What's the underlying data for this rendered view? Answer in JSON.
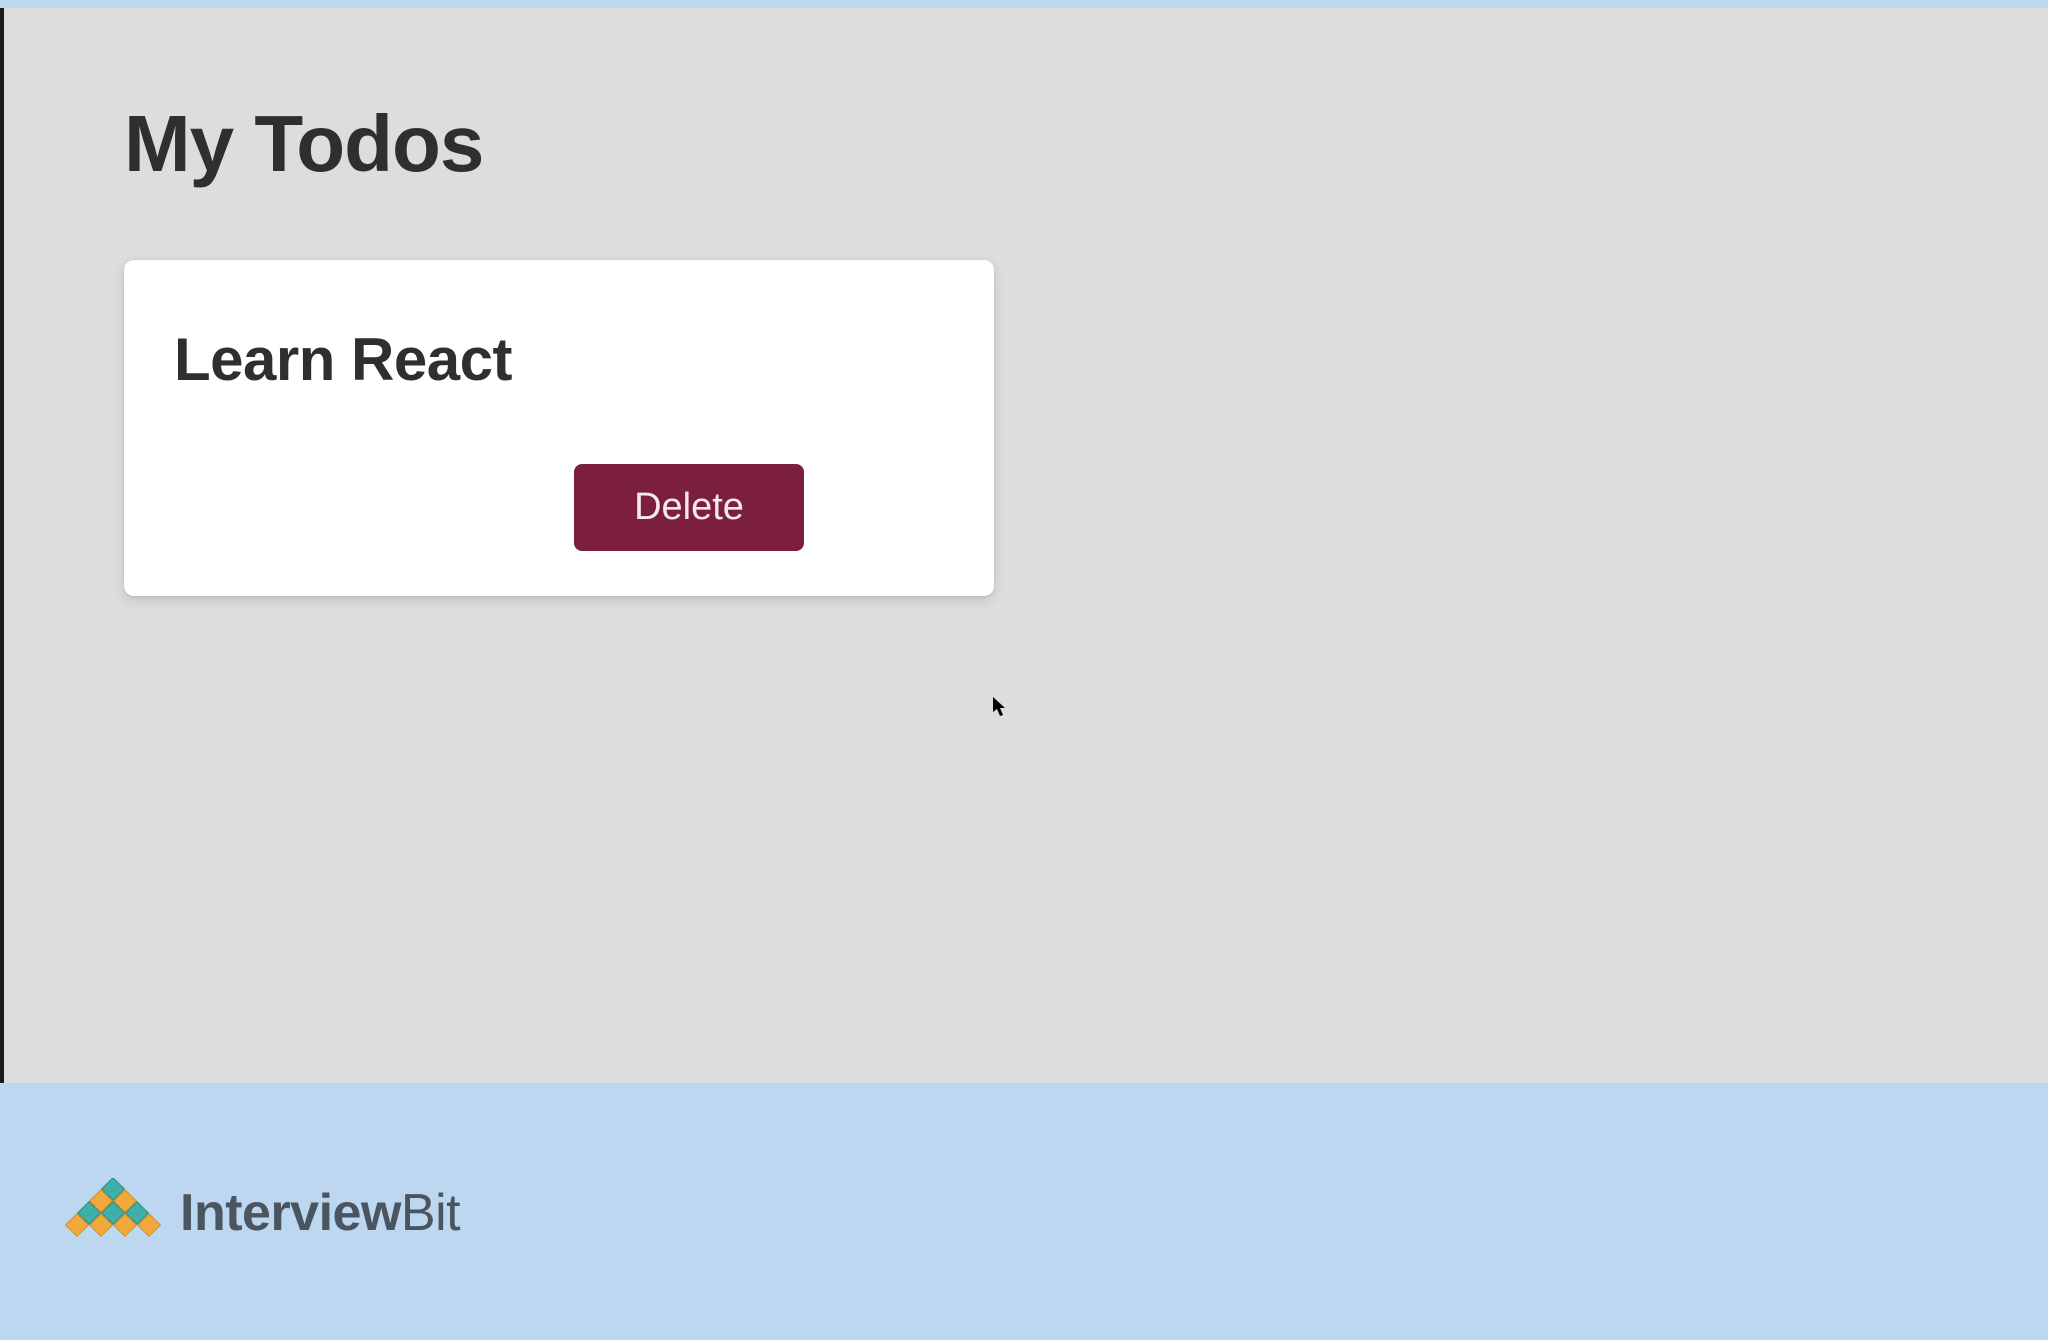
{
  "header": {
    "title": "My Todos"
  },
  "todos": [
    {
      "title": "Learn React",
      "delete_label": "Delete"
    }
  ],
  "footer": {
    "brand_bold": "Interview",
    "brand_light": "Bit"
  },
  "colors": {
    "page_bg": "#bdd7f0",
    "app_bg": "#dddddd",
    "card_bg": "#ffffff",
    "text_dark": "#2f2f2f",
    "button_bg": "#7b1f3d",
    "button_text": "#f5e9ed",
    "brand_text": "#4a5560"
  }
}
